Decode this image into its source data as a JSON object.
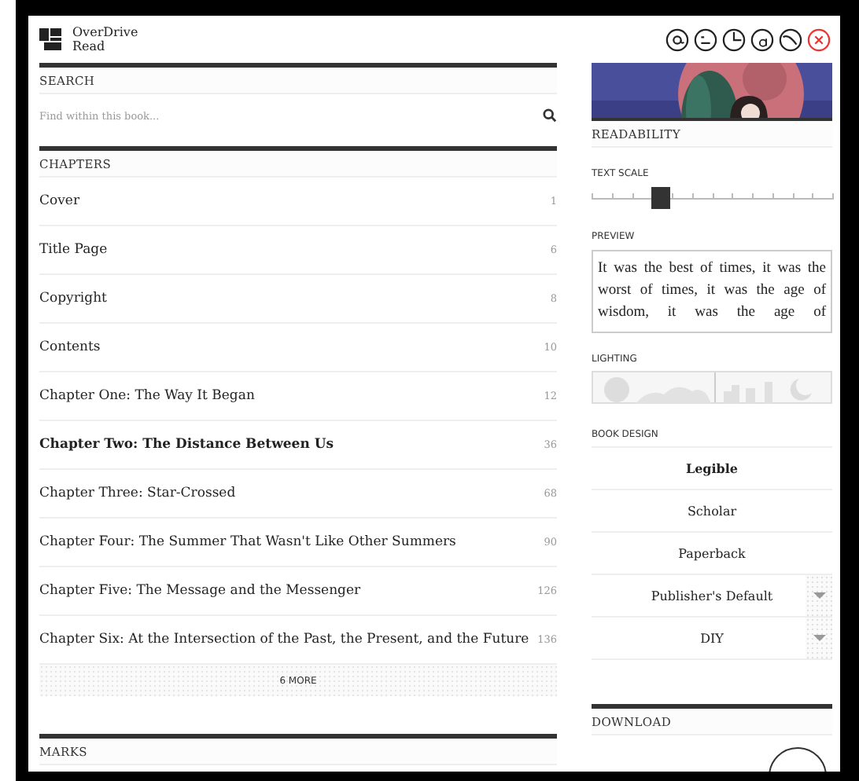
{
  "app": {
    "name_line1": "OverDrive",
    "name_line2": "Read"
  },
  "search": {
    "heading": "SEARCH",
    "placeholder": "Find within this book..."
  },
  "chapters": {
    "heading": "CHAPTERS",
    "more": "6 MORE",
    "items": [
      {
        "title": "Cover",
        "page": "1",
        "selected": false
      },
      {
        "title": "Title Page",
        "page": "6",
        "selected": false
      },
      {
        "title": "Copyright",
        "page": "8",
        "selected": false
      },
      {
        "title": "Contents",
        "page": "10",
        "selected": false
      },
      {
        "title": "Chapter One: The Way It Began",
        "page": "12",
        "selected": false
      },
      {
        "title": "Chapter Two: The Distance Between Us",
        "page": "36",
        "selected": true
      },
      {
        "title": "Chapter Three: Star-Crossed",
        "page": "68",
        "selected": false
      },
      {
        "title": "Chapter Four: The Summer That Wasn't Like Other Summers",
        "page": "90",
        "selected": false
      },
      {
        "title": "Chapter Five: The Message and the Messenger",
        "page": "126",
        "selected": false
      },
      {
        "title": "Chapter Six: At the Intersection of the Past, the Present, and the Future",
        "page": "136",
        "selected": false
      }
    ]
  },
  "marks": {
    "heading": "MARKS"
  },
  "readability": {
    "heading": "READABILITY",
    "text_scale_label": "TEXT SCALE",
    "text_scale": {
      "level": 0.29
    },
    "preview_label": "PREVIEW",
    "preview_text": "It was the best of times, it was the worst of times, it was the age of wisdom, it was the age of",
    "lighting_label": "LIGHTING"
  },
  "book_design": {
    "heading": "BOOK DESIGN",
    "options": [
      {
        "label": "Legible",
        "selected": true,
        "expandable": false
      },
      {
        "label": "Scholar",
        "selected": false,
        "expandable": false
      },
      {
        "label": "Paperback",
        "selected": false,
        "expandable": false
      },
      {
        "label": "Publisher's Default",
        "selected": false,
        "expandable": true
      },
      {
        "label": "DIY",
        "selected": false,
        "expandable": true
      }
    ]
  },
  "download": {
    "heading": "DOWNLOAD"
  }
}
